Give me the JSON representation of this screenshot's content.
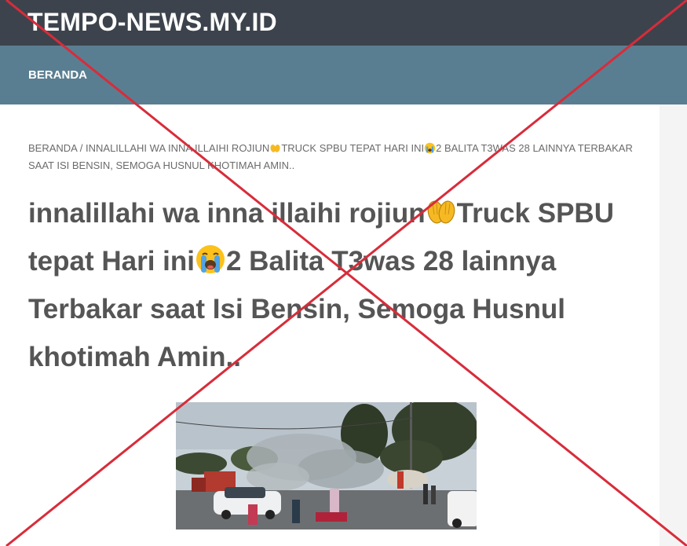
{
  "header": {
    "site_title": "TEMPO-NEWS.MY.ID"
  },
  "nav": {
    "items": [
      {
        "label": "BERANDA"
      }
    ]
  },
  "breadcrumb": {
    "home": "BERANDA",
    "separator": "/",
    "part1": "INNALILLAHI WA INNA ILLAIHI ROJIUN",
    "part2": "TRUCK SPBU TEPAT HARI INI",
    "part3": "2 BALITA T3WAS 28 LAINNYA TERBAKAR SAAT ISI BENSIN, SEMOGA HUSNUL KHOTIMAH AMIN.."
  },
  "article": {
    "title_part1": "innalillahi wa inna illaihi rojiun",
    "title_part2": "Truck SPBU tepat Hari ini",
    "title_part3": "2 Balita T3was 28 lainnya Terbakar saat Isi Bensin, Semoga Husnul khotimah Amin..",
    "emoji_1": "raised-hands-emoji",
    "emoji_2": "crying-face-emoji"
  },
  "image": {
    "subject": "street-fire-photo"
  },
  "colors": {
    "topbar": "#3d434c",
    "navbar": "#5a7e91",
    "headline": "#555555",
    "breadcrumb": "#6b6b6b",
    "cross": "#d82c3a"
  }
}
